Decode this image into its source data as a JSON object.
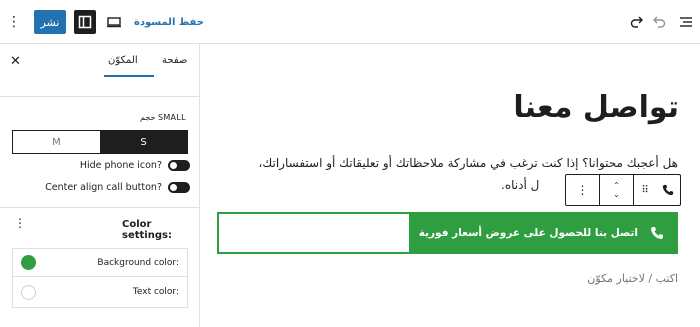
{
  "topbar": {
    "publish_label": "نشر",
    "save_draft_label": "حفظ المسودة",
    "icons": [
      "options-icon",
      "sidebar-toggle-icon",
      "desktop-preview-icon",
      "redo-icon",
      "undo-icon",
      "document-overview-icon"
    ]
  },
  "sidebar": {
    "tabs": [
      {
        "label": "المكوّن",
        "active": true
      },
      {
        "label": "صفحة",
        "active": false
      }
    ],
    "size": {
      "label": "حجم SMALL",
      "options": [
        "M",
        "S"
      ],
      "selected": "S"
    },
    "toggles": [
      {
        "label": "Hide phone icon?",
        "on": true
      },
      {
        "label": "Center align call button?",
        "on": true
      }
    ],
    "color_settings": {
      "title": "Color settings:",
      "rows": [
        {
          "label": "Background color:",
          "color": "#2e9e41"
        },
        {
          "label": "Text color:",
          "color": ""
        }
      ]
    }
  },
  "canvas": {
    "heading": "تواصل معنا",
    "paragraph_line1": "هل أعجبك محتوانا؟ إذا كنت ترغب في مشاركة ملاحظاتك أو تعليقاتك أو استفساراتك،",
    "paragraph_line2": "ل أدناه.",
    "cta_label": "اتصل بنا للحصول على عروض أسعار فورية",
    "placeholder": "اكتب / لاختيار مكوّن"
  },
  "colors": {
    "accent": "#2271b1",
    "cta_green": "#2e9e41",
    "dark": "#1e1e1e"
  }
}
